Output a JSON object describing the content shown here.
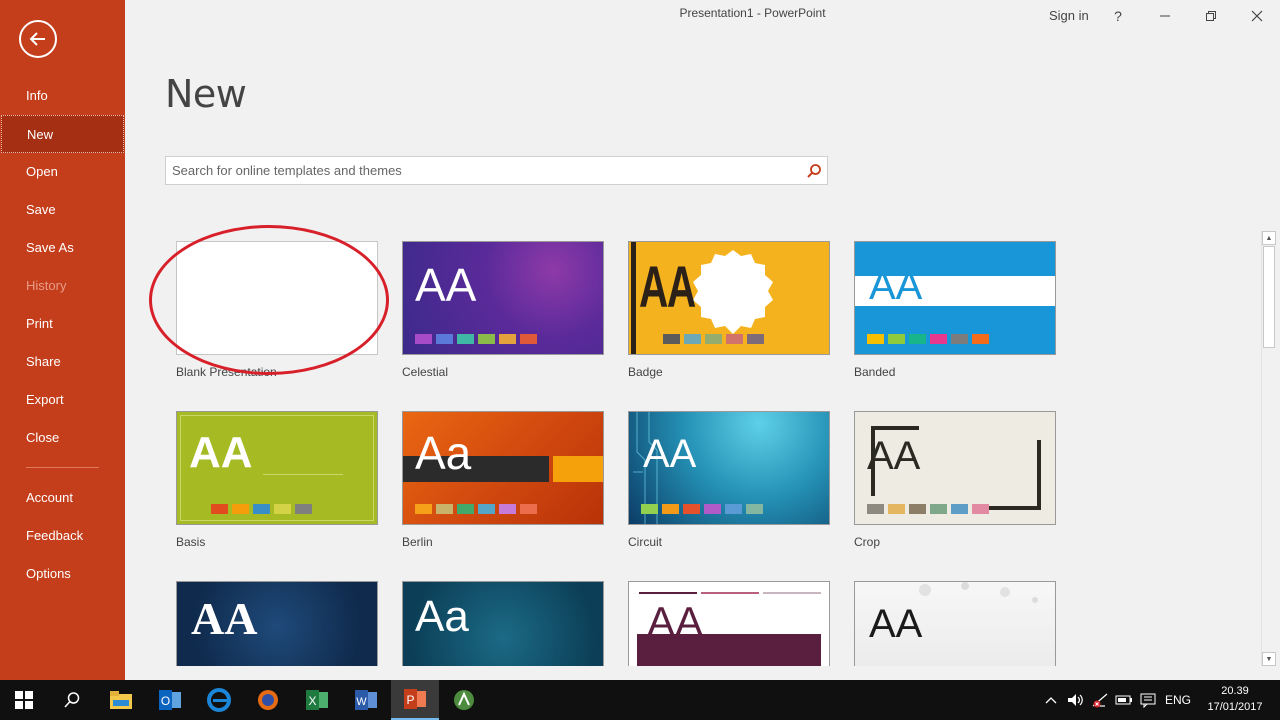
{
  "app": {
    "title": "Presentation1  -  PowerPoint",
    "sign_in": "Sign in",
    "help": "?"
  },
  "sidebar": {
    "items": [
      {
        "label": "Info"
      },
      {
        "label": "New"
      },
      {
        "label": "Open"
      },
      {
        "label": "Save"
      },
      {
        "label": "Save As"
      },
      {
        "label": "History"
      },
      {
        "label": "Print"
      },
      {
        "label": "Share"
      },
      {
        "label": "Export"
      },
      {
        "label": "Close"
      },
      {
        "label": "Account"
      },
      {
        "label": "Feedback"
      },
      {
        "label": "Options"
      }
    ],
    "selected": "New",
    "disabled": "History"
  },
  "main": {
    "heading": "New",
    "search": {
      "placeholder": "Search for online templates and themes"
    },
    "templates": [
      {
        "label": "Blank Presentation"
      },
      {
        "label": "Celestial"
      },
      {
        "label": "Badge"
      },
      {
        "label": "Banded"
      },
      {
        "label": "Basis"
      },
      {
        "label": "Berlin"
      },
      {
        "label": "Circuit"
      },
      {
        "label": "Crop"
      }
    ],
    "thumb_text": {
      "celestial": "AA",
      "badge": "AA",
      "banded": "AA",
      "basis": "AA",
      "berlin": "Aa",
      "circuit": "AA",
      "crop": "AA",
      "row3_1": "AA",
      "row3_2": "Aa",
      "row3_3": "AA",
      "row3_4": "AA"
    }
  },
  "colors": {
    "sidebar_bg": "#c43e1c",
    "sidebar_selected": "#a52f13",
    "annotation_oval": "#d8202a"
  },
  "taskbar": {
    "language": "ENG",
    "time": "20.39",
    "date": "17/01/2017"
  }
}
